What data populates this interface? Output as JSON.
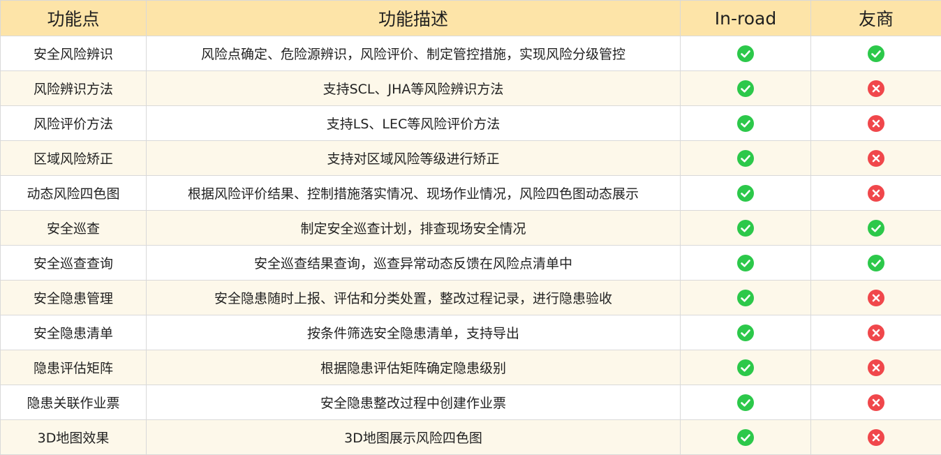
{
  "headers": {
    "feature": "功能点",
    "description": "功能描述",
    "inroad": "In-road",
    "competitor": "友商"
  },
  "rows": [
    {
      "feature": "安全风险辨识",
      "description": "风险点确定、危险源辨识，风险评价、制定管控措施，实现风险分级管控",
      "inroad": true,
      "competitor": true
    },
    {
      "feature": "风险辨识方法",
      "description": "支持SCL、JHA等风险辨识方法",
      "inroad": true,
      "competitor": false
    },
    {
      "feature": "风险评价方法",
      "description": "支持LS、LEC等风险评价方法",
      "inroad": true,
      "competitor": false
    },
    {
      "feature": "区域风险矫正",
      "description": "支持对区域风险等级进行矫正",
      "inroad": true,
      "competitor": false
    },
    {
      "feature": "动态风险四色图",
      "description": "根据风险评价结果、控制措施落实情况、现场作业情况，风险四色图动态展示",
      "inroad": true,
      "competitor": false
    },
    {
      "feature": "安全巡查",
      "description": "制定安全巡查计划，排查现场安全情况",
      "inroad": true,
      "competitor": true
    },
    {
      "feature": "安全巡查查询",
      "description": "安全巡查结果查询，巡查异常动态反馈在风险点清单中",
      "inroad": true,
      "competitor": true
    },
    {
      "feature": "安全隐患管理",
      "description": "安全隐患随时上报、评估和分类处置，整改过程记录，进行隐患验收",
      "inroad": true,
      "competitor": false
    },
    {
      "feature": "安全隐患清单",
      "description": "按条件筛选安全隐患清单，支持导出",
      "inroad": true,
      "competitor": false
    },
    {
      "feature": "隐患评估矩阵",
      "description": "根据隐患评估矩阵确定隐患级别",
      "inroad": true,
      "competitor": false
    },
    {
      "feature": "隐患关联作业票",
      "description": "安全隐患整改过程中创建作业票",
      "inroad": true,
      "competitor": false
    },
    {
      "feature": "3D地图效果",
      "description": "3D地图展示风险四色图",
      "inroad": true,
      "competitor": false
    }
  ],
  "icons": {
    "yes": "check-circle-icon",
    "no": "x-circle-icon"
  },
  "colors": {
    "header_bg": "#fde4a8",
    "stripe_bg": "#fdf8ea",
    "check_green": "#2cc84a",
    "cross_red": "#f0474b",
    "border": "#d9d9d9"
  }
}
